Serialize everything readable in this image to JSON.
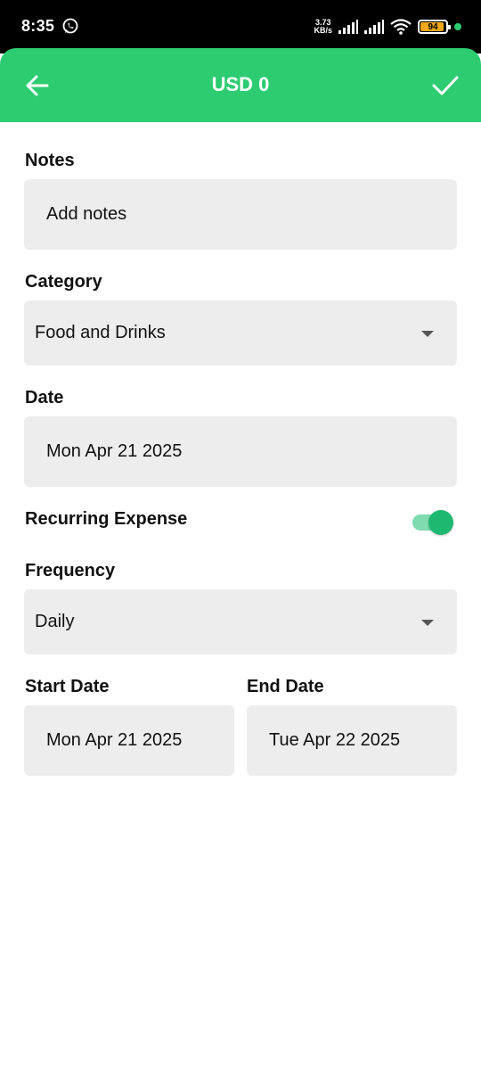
{
  "status_bar": {
    "time": "8:35",
    "net_speed_value": "3.73",
    "net_speed_unit": "KB/s",
    "battery_level": "94",
    "icons": [
      "whatsapp-icon",
      "signal-icon",
      "signal-icon",
      "wifi-icon",
      "battery-icon",
      "notification-dot"
    ]
  },
  "appbar": {
    "title": "USD 0",
    "back_icon": "arrow-left-icon",
    "confirm_icon": "check-icon",
    "color": "#2ecc71"
  },
  "form": {
    "notes": {
      "label": "Notes",
      "placeholder": "Add notes"
    },
    "category": {
      "label": "Category",
      "value": "Food and Drinks"
    },
    "date": {
      "label": "Date",
      "value": "Mon Apr 21 2025"
    },
    "recurring": {
      "label": "Recurring Expense",
      "enabled": true
    },
    "frequency": {
      "label": "Frequency",
      "value": "Daily"
    },
    "start_date": {
      "label": "Start Date",
      "value": "Mon Apr 21 2025"
    },
    "end_date": {
      "label": "End Date",
      "value": "Tue Apr 22 2025"
    }
  },
  "colors": {
    "accent": "#2ecc71",
    "field_bg": "#ededed",
    "toggle_on": "#1fb870"
  }
}
